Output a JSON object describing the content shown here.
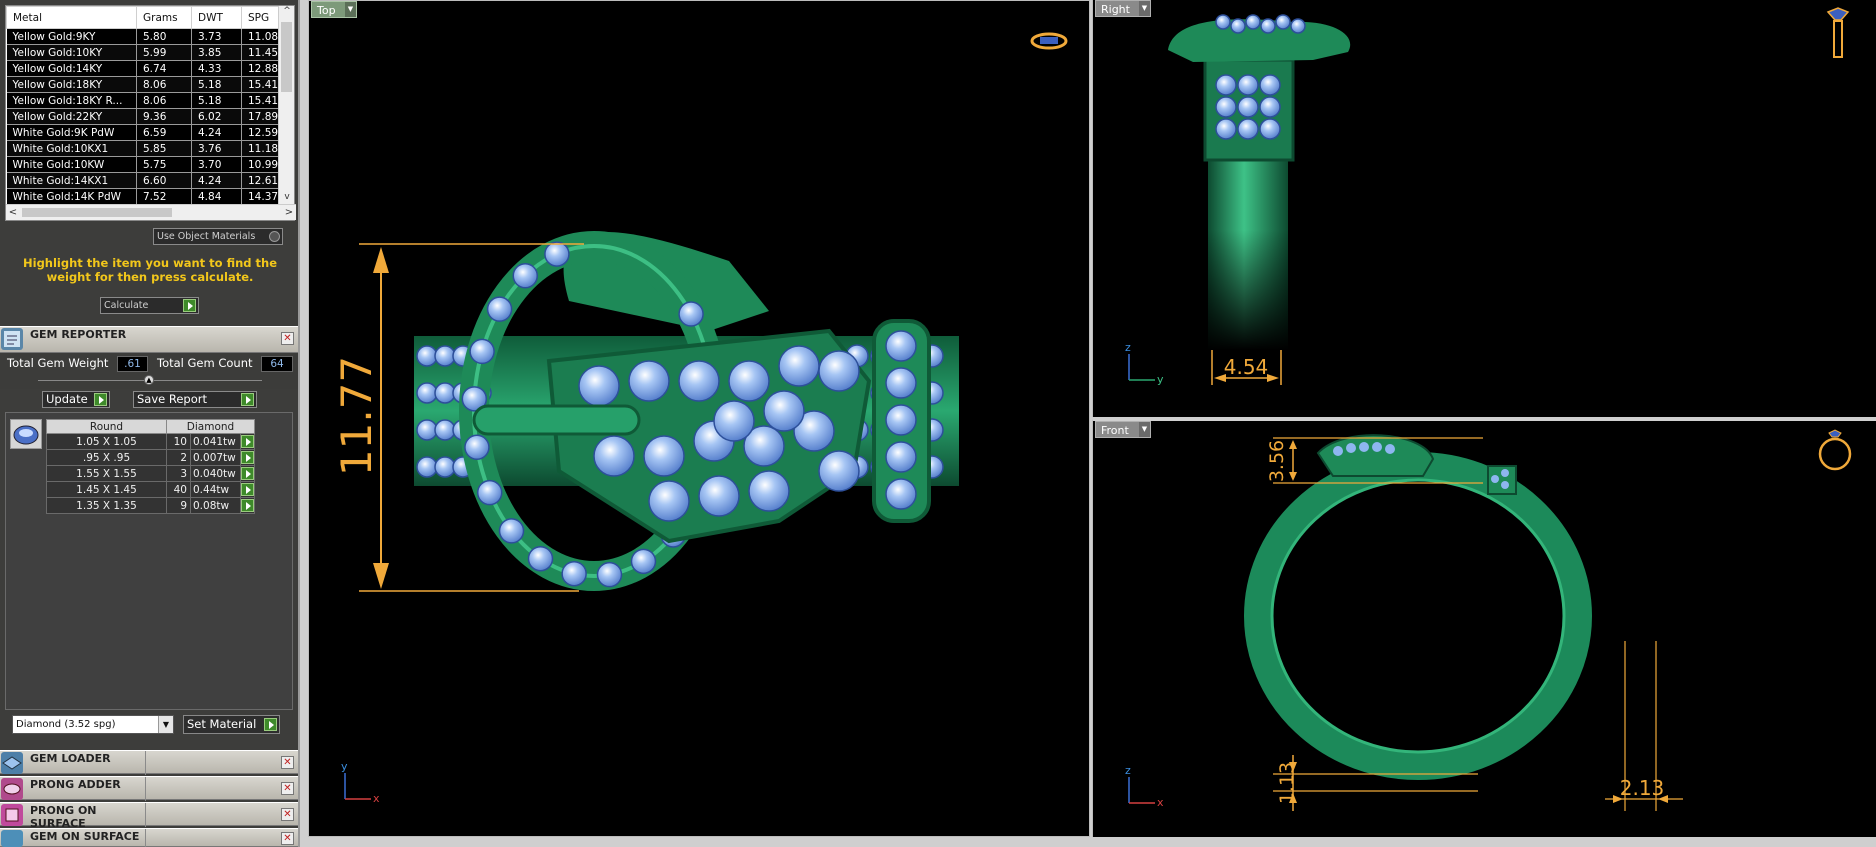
{
  "metal_table": {
    "headers": [
      "Metal",
      "Grams",
      "DWT",
      "SPG"
    ],
    "rows": [
      [
        "Yellow Gold:9KY",
        "5.80",
        "3.73",
        "11.08"
      ],
      [
        "Yellow Gold:10KY",
        "5.99",
        "3.85",
        "11.45"
      ],
      [
        "Yellow Gold:14KY",
        "6.74",
        "4.33",
        "12.88"
      ],
      [
        "Yellow Gold:18KY",
        "8.06",
        "5.18",
        "15.41"
      ],
      [
        "Yellow Gold:18KY R...",
        "8.06",
        "5.18",
        "15.41"
      ],
      [
        "Yellow Gold:22KY",
        "9.36",
        "6.02",
        "17.89"
      ],
      [
        "White Gold:9K PdW",
        "6.59",
        "4.24",
        "12.59"
      ],
      [
        "White Gold:10KX1",
        "5.85",
        "3.76",
        "11.18"
      ],
      [
        "White Gold:10KW",
        "5.75",
        "3.70",
        "10.99"
      ],
      [
        "White Gold:14KX1",
        "6.60",
        "4.24",
        "12.61"
      ],
      [
        "White Gold:14K PdW",
        "7.52",
        "4.84",
        "14.37"
      ]
    ],
    "scroll_up": "^",
    "scroll_down": "v",
    "scroll_left": "<",
    "scroll_right": ">"
  },
  "use_object_materials": "Use Object Materials",
  "hint": "Highlight the item you want to find the weight for then press calculate.",
  "calculate_label": "Calculate",
  "gem_reporter": {
    "title": "GEM REPORTER",
    "total_weight_label": "Total Gem Weight",
    "total_weight_value": ".61",
    "total_count_label": "Total Gem Count",
    "total_count_value": "64",
    "update_label": "Update",
    "save_report_label": "Save Report",
    "columns": [
      "Round",
      "Diamond"
    ],
    "rows": [
      {
        "size": "1.05 X 1.05",
        "count": "10",
        "tw": "0.041tw"
      },
      {
        "size": ".95 X .95",
        "count": "2",
        "tw": "0.007tw"
      },
      {
        "size": "1.55 X 1.55",
        "count": "3",
        "tw": "0.040tw"
      },
      {
        "size": "1.45 X 1.45",
        "count": "40",
        "tw": "0.44tw"
      },
      {
        "size": "1.35 X 1.35",
        "count": "9",
        "tw": "0.08tw"
      }
    ],
    "material_select": "Diamond    (3.52 spg)",
    "set_material_label": "Set Material"
  },
  "collapsed_sections": [
    {
      "title": "GEM LOADER",
      "icon": "gem-loader-icon"
    },
    {
      "title": "PRONG ADDER",
      "icon": "prong-adder-icon"
    },
    {
      "title": "PRONG ON SURFACE",
      "icon": "prong-on-surface-icon"
    },
    {
      "title": "GEM ON SURFACE",
      "icon": "gem-on-surface-icon"
    }
  ],
  "viewports": {
    "top": {
      "label": "Top",
      "dimension": "11.77",
      "axis_v": "y",
      "axis_h": "x"
    },
    "right": {
      "label": "Right",
      "dimension": "4.54",
      "axis_v": "z",
      "axis_h": "y"
    },
    "front": {
      "label": "Front",
      "dimension_height": "3.56",
      "dimension_base": "1.13",
      "dimension_side": "2.13",
      "axis_v": "z",
      "axis_h": "x"
    }
  },
  "colors": {
    "metal_green": "#1f8a5c",
    "gem_blue": "#8eb6f0",
    "dimension_orange": "#f0a93a",
    "panel_bg": "#3d3d3b",
    "hint_yellow": "#f2c71b"
  }
}
